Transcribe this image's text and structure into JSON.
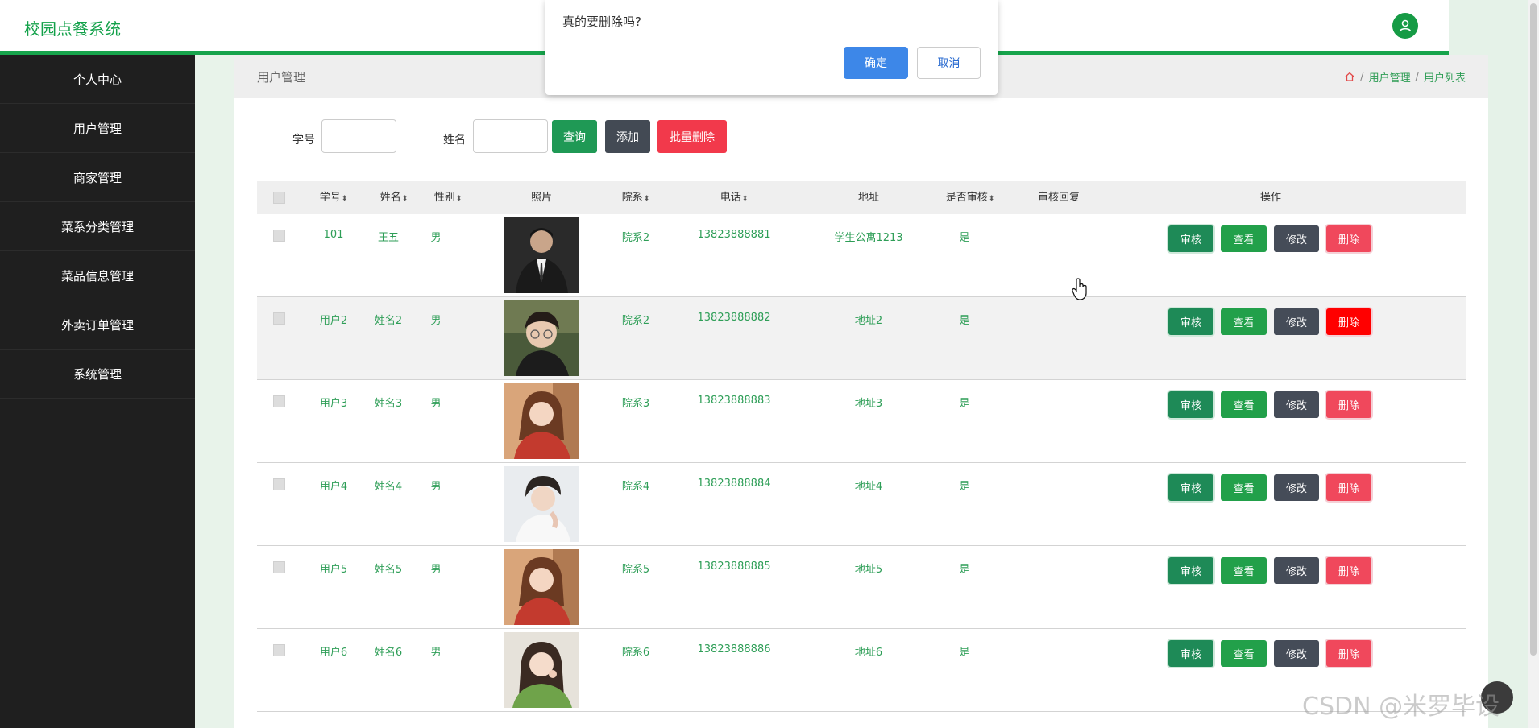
{
  "app": {
    "title": "校园点餐系统"
  },
  "sidebar": {
    "items": [
      "个人中心",
      "用户管理",
      "商家管理",
      "菜系分类管理",
      "菜品信息管理",
      "外卖订单管理",
      "系统管理"
    ]
  },
  "panel": {
    "title": "用户管理",
    "breadcrumb": [
      "用户管理",
      "用户列表"
    ]
  },
  "search": {
    "student_id_label": "学号",
    "name_label": "姓名",
    "student_id_value": "",
    "name_value": "",
    "query_button": "查询",
    "add_button": "添加",
    "bulk_delete_button": "批量删除"
  },
  "table": {
    "headers": {
      "student_id": "学号",
      "name": "姓名",
      "gender": "性别",
      "photo": "照片",
      "department": "院系",
      "phone": "电话",
      "address": "地址",
      "approved": "是否审核",
      "reply": "审核回复",
      "actions": "操作"
    },
    "action_labels": {
      "audit": "审核",
      "view": "查看",
      "edit": "修改",
      "delete": "删除"
    },
    "rows": [
      {
        "student_id": "101",
        "name": "王五",
        "gender": "男",
        "department": "院系2",
        "phone": "13823888881",
        "address": "学生公寓1213",
        "approved": "是",
        "reply": ""
      },
      {
        "student_id": "用户2",
        "name": "姓名2",
        "gender": "男",
        "department": "院系2",
        "phone": "13823888882",
        "address": "地址2",
        "approved": "是",
        "reply": ""
      },
      {
        "student_id": "用户3",
        "name": "姓名3",
        "gender": "男",
        "department": "院系3",
        "phone": "13823888883",
        "address": "地址3",
        "approved": "是",
        "reply": ""
      },
      {
        "student_id": "用户4",
        "name": "姓名4",
        "gender": "男",
        "department": "院系4",
        "phone": "13823888884",
        "address": "地址4",
        "approved": "是",
        "reply": ""
      },
      {
        "student_id": "用户5",
        "name": "姓名5",
        "gender": "男",
        "department": "院系5",
        "phone": "13823888885",
        "address": "地址5",
        "approved": "是",
        "reply": ""
      },
      {
        "student_id": "用户6",
        "name": "姓名6",
        "gender": "男",
        "department": "院系6",
        "phone": "13823888886",
        "address": "地址6",
        "approved": "是",
        "reply": ""
      }
    ]
  },
  "dialog": {
    "message": "真的要删除吗?",
    "ok": "确定",
    "cancel": "取消"
  },
  "watermark": "CSDN @米罗毕设",
  "colors": {
    "brand": "#13a14a",
    "sidebar": "#1f1f1f",
    "delete": "#f0485c"
  }
}
